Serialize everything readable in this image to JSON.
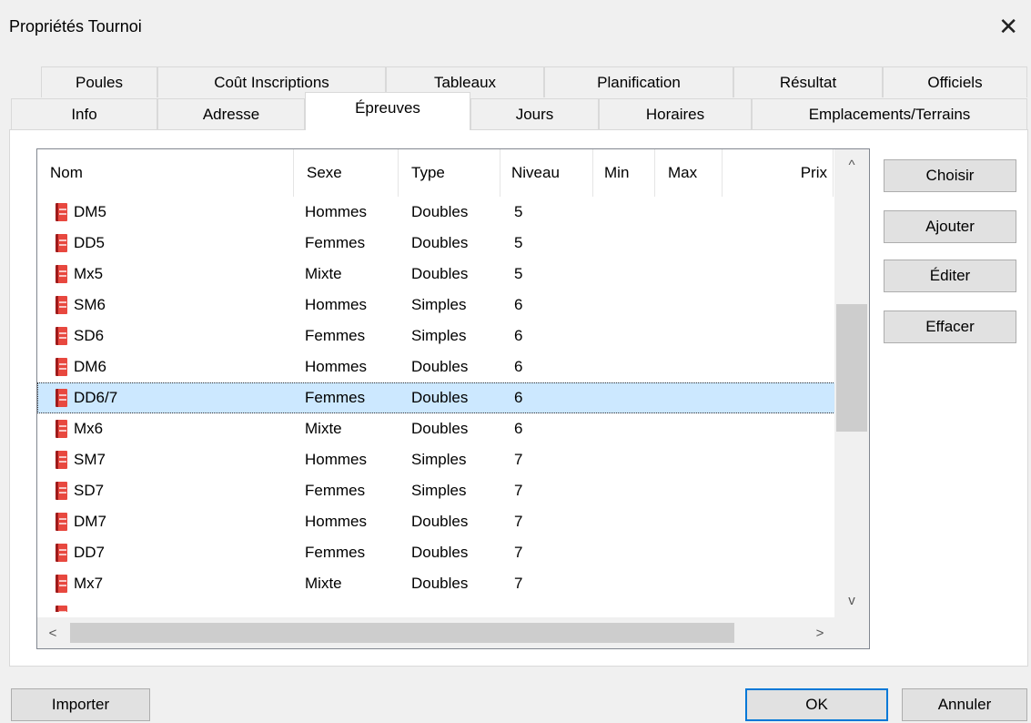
{
  "window": {
    "title": "Propriétés Tournoi",
    "close_glyph": "✕"
  },
  "tabs_row1": [
    "Poules",
    "Coût Inscriptions",
    "Tableaux",
    "Planification",
    "Résultat",
    "Officiels"
  ],
  "tabs_row2": [
    "Info",
    "Adresse",
    "Épreuves",
    "Jours",
    "Horaires",
    "Emplacements/Terrains"
  ],
  "active_tab": "Épreuves",
  "list": {
    "columns": [
      "Nom",
      "Sexe",
      "Type",
      "Niveau",
      "Min",
      "Max",
      "Prix"
    ],
    "rows": [
      {
        "nom": "DM5",
        "sexe": "Hommes",
        "type": "Doubles",
        "niveau": "5"
      },
      {
        "nom": "DD5",
        "sexe": "Femmes",
        "type": "Doubles",
        "niveau": "5"
      },
      {
        "nom": "Mx5",
        "sexe": "Mixte",
        "type": "Doubles",
        "niveau": "5"
      },
      {
        "nom": "SM6",
        "sexe": "Hommes",
        "type": "Simples",
        "niveau": "6"
      },
      {
        "nom": "SD6",
        "sexe": "Femmes",
        "type": "Simples",
        "niveau": "6"
      },
      {
        "nom": "DM6",
        "sexe": "Hommes",
        "type": "Doubles",
        "niveau": "6"
      },
      {
        "nom": "DD6/7",
        "sexe": "Femmes",
        "type": "Doubles",
        "niveau": "6",
        "selected": true
      },
      {
        "nom": "Mx6",
        "sexe": "Mixte",
        "type": "Doubles",
        "niveau": "6"
      },
      {
        "nom": "SM7",
        "sexe": "Hommes",
        "type": "Simples",
        "niveau": "7"
      },
      {
        "nom": "SD7",
        "sexe": "Femmes",
        "type": "Simples",
        "niveau": "7"
      },
      {
        "nom": "DM7",
        "sexe": "Hommes",
        "type": "Doubles",
        "niveau": "7"
      },
      {
        "nom": "DD7",
        "sexe": "Femmes",
        "type": "Doubles",
        "niveau": "7"
      },
      {
        "nom": "Mx7",
        "sexe": "Mixte",
        "type": "Doubles",
        "niveau": "7"
      }
    ],
    "row_icon": "event-book-icon",
    "scroll_up_glyph": "^",
    "scroll_down_glyph": "v",
    "scroll_left_glyph": "<",
    "scroll_right_glyph": ">"
  },
  "side_buttons": [
    "Choisir",
    "Ajouter",
    "Éditer",
    "Effacer"
  ],
  "footer": {
    "import": "Importer",
    "ok": "OK",
    "cancel": "Annuler"
  },
  "colors": {
    "selection": "#cce8ff",
    "icon_red": "#e8483f",
    "accent": "#0078d7"
  }
}
